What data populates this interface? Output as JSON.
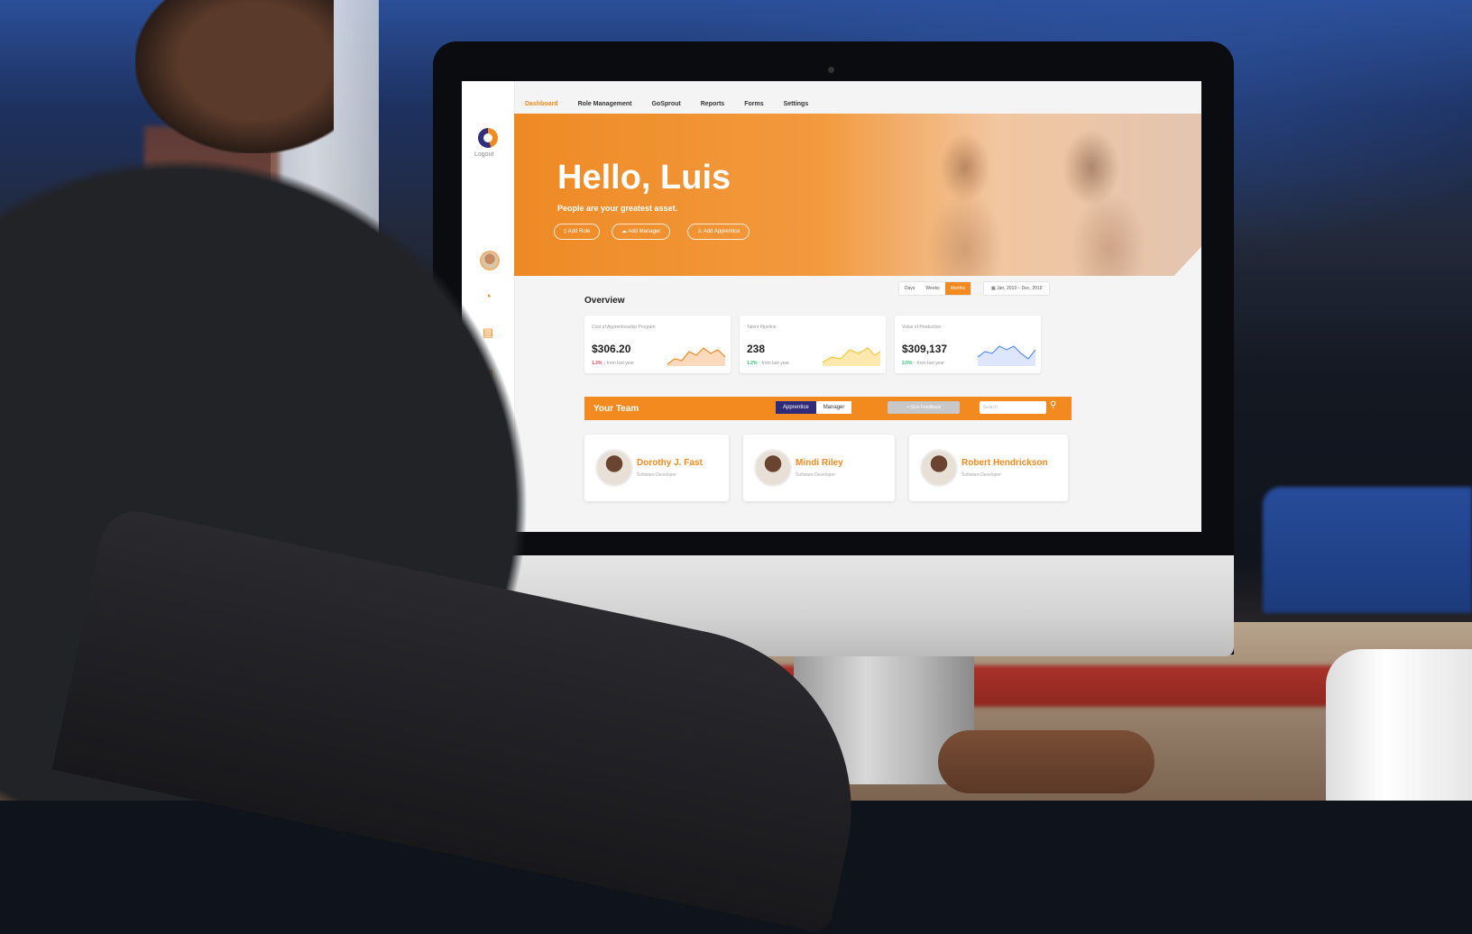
{
  "nav": {
    "items": [
      "Dashboard",
      "Role Management",
      "GoSprout",
      "Reports",
      "Forms",
      "Settings"
    ],
    "active": "Dashboard"
  },
  "sidebar": {
    "logout_label": "Logout"
  },
  "hero": {
    "greeting": "Hello, Luis",
    "tagline": "People are your greatest asset.",
    "buttons": [
      "Add Role",
      "Add Manager",
      "Add Apprentice"
    ]
  },
  "overview": {
    "title": "Overview",
    "ranges": [
      "Days",
      "Weeks",
      "Months"
    ],
    "active_range": "Months",
    "date_range": "Jan, 2019 – Dec, 2019",
    "stats": [
      {
        "label": "Cost of Apprenticeship Program",
        "value": "$306.20",
        "change": "1.2%",
        "change_note": "from last year",
        "trend": "down",
        "color": "#f28a1f"
      },
      {
        "label": "Talent Pipeline",
        "value": "238",
        "change": "1.2%",
        "change_note": "from last year",
        "trend": "up",
        "color": "#f5c63a"
      },
      {
        "label": "Value of Production",
        "value": "$309,137",
        "change": "2.5%",
        "change_note": "from last year",
        "trend": "up",
        "color": "#5b8ff0"
      }
    ]
  },
  "team": {
    "title": "Your Team",
    "tabs": [
      "Apprentice",
      "Manager"
    ],
    "active_tab": "Apprentice",
    "feedback_label": "Give Feedback",
    "search_placeholder": "Search",
    "members": [
      {
        "name": "Dorothy J. Fast",
        "role": "Software Developer"
      },
      {
        "name": "Mindi Riley",
        "role": "Software Developer"
      },
      {
        "name": "Robert Hendrickson",
        "role": "Software Developer"
      }
    ]
  },
  "colors": {
    "accent": "#f28a1f",
    "navy": "#2f2b78"
  }
}
